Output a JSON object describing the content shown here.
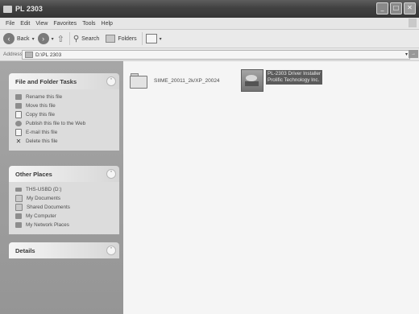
{
  "window": {
    "title": "PL 2303"
  },
  "menu": {
    "items": [
      "File",
      "Edit",
      "View",
      "Favorites",
      "Tools",
      "Help"
    ]
  },
  "toolbar": {
    "back_label": "Back",
    "search_label": "Search",
    "folders_label": "Folders"
  },
  "address": {
    "label": "Address",
    "value": "D:\\PL 2303"
  },
  "sidebar": {
    "file_tasks": {
      "title": "File and Folder Tasks",
      "items": [
        {
          "label": "Rename this file",
          "icon": "rename-icon"
        },
        {
          "label": "Move this file",
          "icon": "move-icon"
        },
        {
          "label": "Copy this file",
          "icon": "copy-icon"
        },
        {
          "label": "Publish this file to the Web",
          "icon": "publish-icon"
        },
        {
          "label": "E-mail this file",
          "icon": "email-icon"
        },
        {
          "label": "Delete this file",
          "icon": "delete-icon"
        }
      ]
    },
    "other_places": {
      "title": "Other Places",
      "items": [
        {
          "label": "THS-USBD (D:)",
          "icon": "drive-icon"
        },
        {
          "label": "My Documents",
          "icon": "my-documents-icon"
        },
        {
          "label": "Shared Documents",
          "icon": "shared-documents-icon"
        },
        {
          "label": "My Computer",
          "icon": "my-computer-icon"
        },
        {
          "label": "My Network Places",
          "icon": "network-places-icon"
        }
      ]
    },
    "details": {
      "title": "Details"
    }
  },
  "files": {
    "folder": {
      "name": "SIIME_20011_2k/XP_20024"
    },
    "setup": {
      "line1": "PL-2303 Driver Installer",
      "line2": "Prolific Technology Inc."
    }
  }
}
